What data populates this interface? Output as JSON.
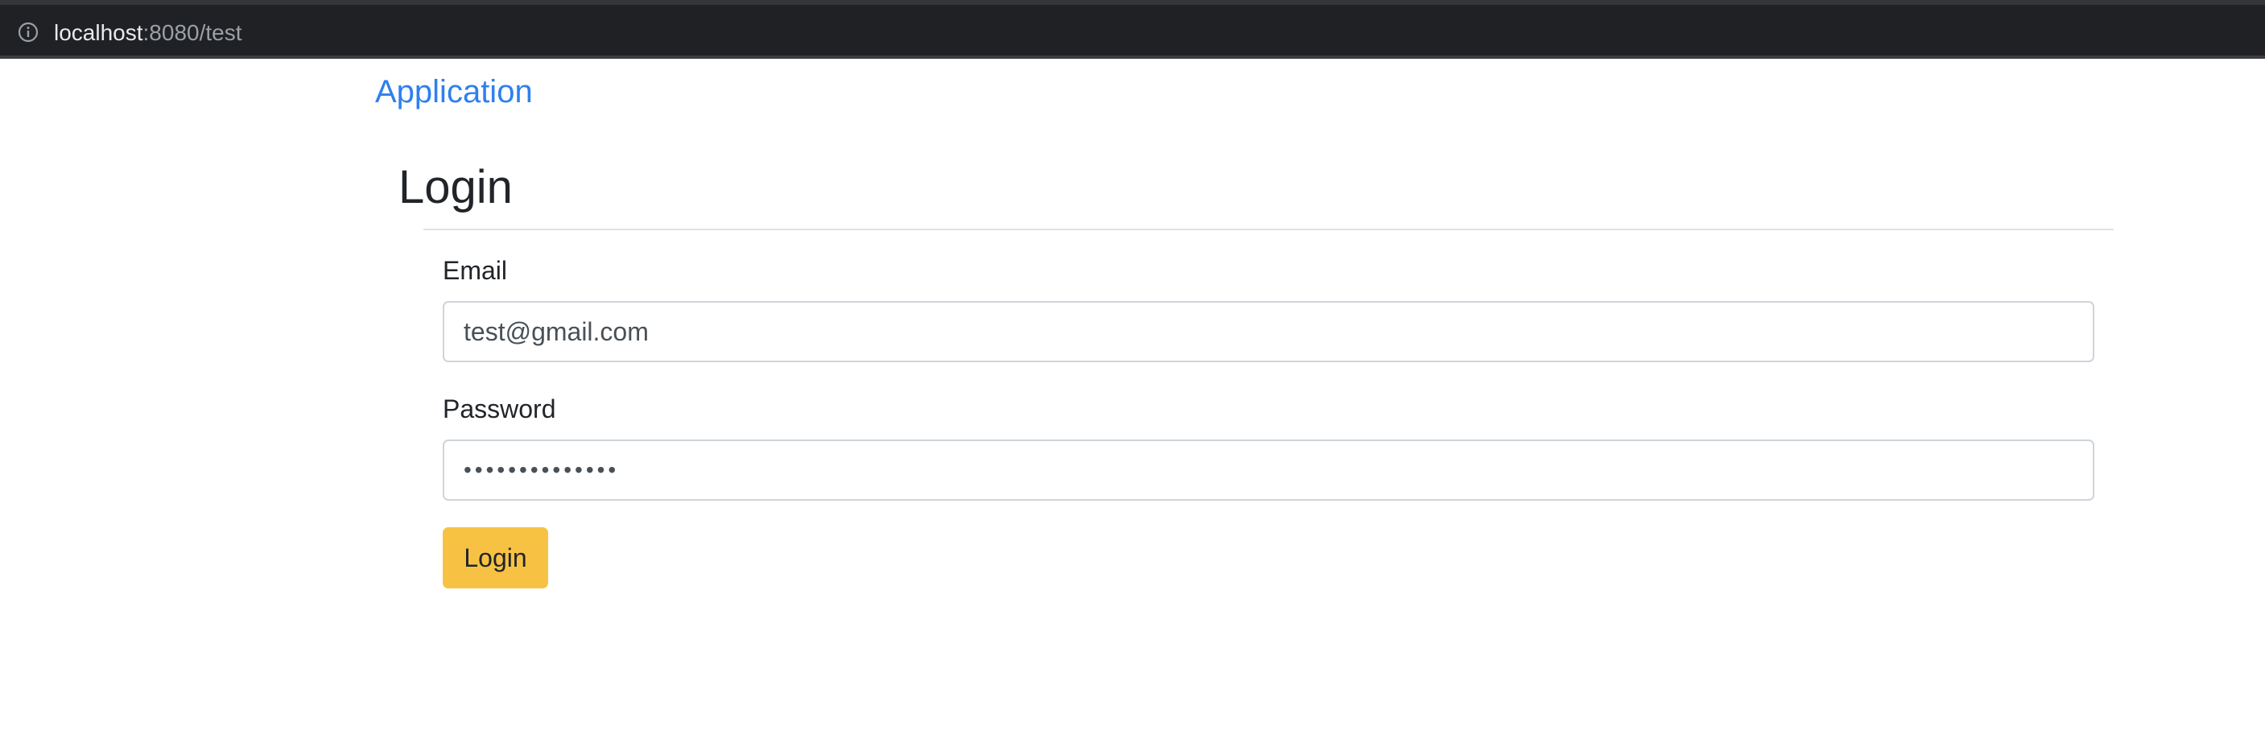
{
  "browser": {
    "url_host": "localhost",
    "url_rest": ":8080/test",
    "info_icon": "info-circle-icon"
  },
  "navbar": {
    "brand": "Application"
  },
  "page": {
    "title": "Login"
  },
  "form": {
    "email_label": "Email",
    "email_value": "test@gmail.com",
    "password_label": "Password",
    "password_value": "••••••••••••••",
    "submit_label": "Login"
  },
  "colors": {
    "brand_link": "#2f80ed",
    "button_warning": "#f7c244",
    "browser_bar": "#202124"
  }
}
